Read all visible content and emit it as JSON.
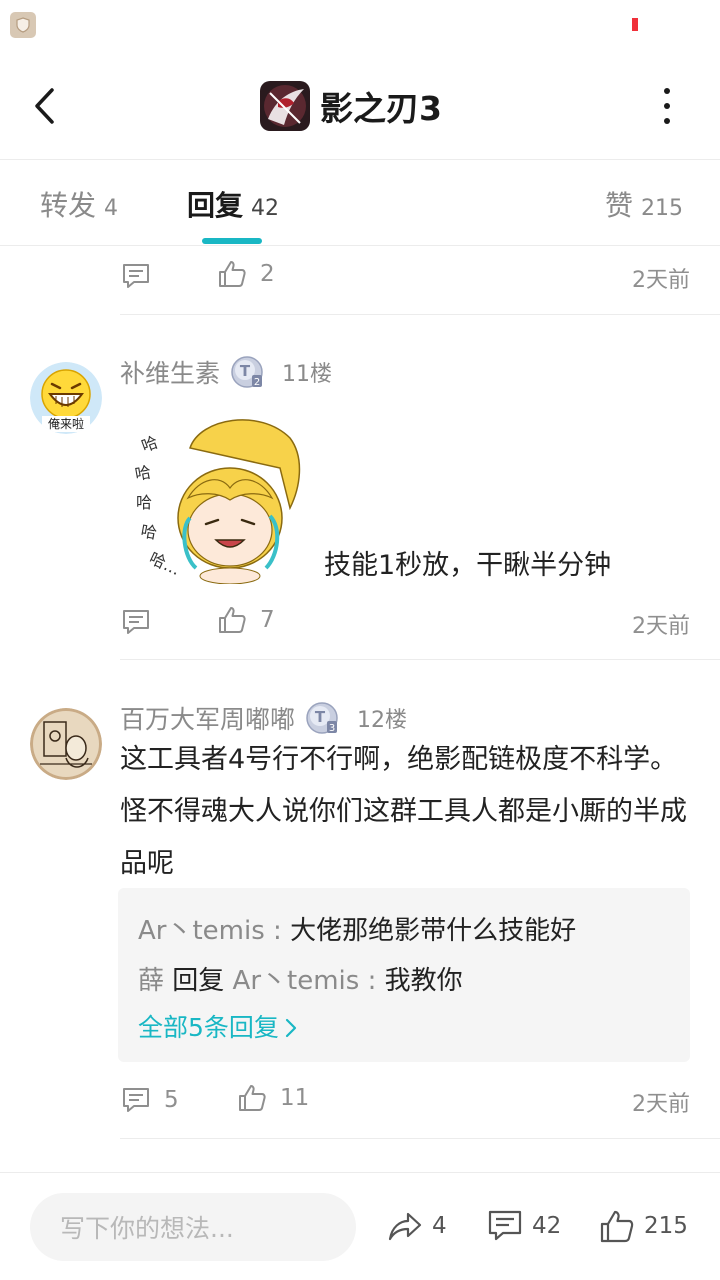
{
  "header": {
    "title": "影之刃3"
  },
  "tabs": [
    {
      "label": "转发",
      "count": "4"
    },
    {
      "label": "回复",
      "count": "42"
    },
    {
      "label": "赞",
      "count": "215"
    }
  ],
  "prev_comment": {
    "like_count": "2",
    "time": "2天前"
  },
  "comments": [
    {
      "username": "补维生素",
      "badge_level": "2",
      "floor": "11楼",
      "avatar_text": "俺来啦",
      "sticker_laugh": "哈哈哈哈哈…",
      "text": "技能1秒放，干瞅半分钟",
      "like_count": "7",
      "time": "2天前"
    },
    {
      "username": "百万大军周嘟嘟",
      "badge_level": "3",
      "floor": "12楼",
      "text": "这工具者4号行不行啊，绝影配链极度不科学。怪不得魂大人说你们这群工具人都是小厮的半成品呢",
      "replies": [
        {
          "author": "Ar丶temis",
          "separator": " : ",
          "text": "大佬那绝影带什么技能好"
        },
        {
          "author": "薛",
          "reply_word": " 回复 ",
          "target": "Ar丶temis",
          "separator": " : ",
          "text": "我教你"
        }
      ],
      "all_replies_label": "全部5条回复",
      "reply_count": "5",
      "like_count": "11",
      "time": "2天前"
    }
  ],
  "bottom_bar": {
    "input_placeholder": "写下你的想法...",
    "share_count": "4",
    "comment_count": "42",
    "like_count": "215"
  },
  "colors": {
    "accent": "#19b7c4",
    "muted": "#8a8a8a",
    "status_red": "#f0303a"
  }
}
